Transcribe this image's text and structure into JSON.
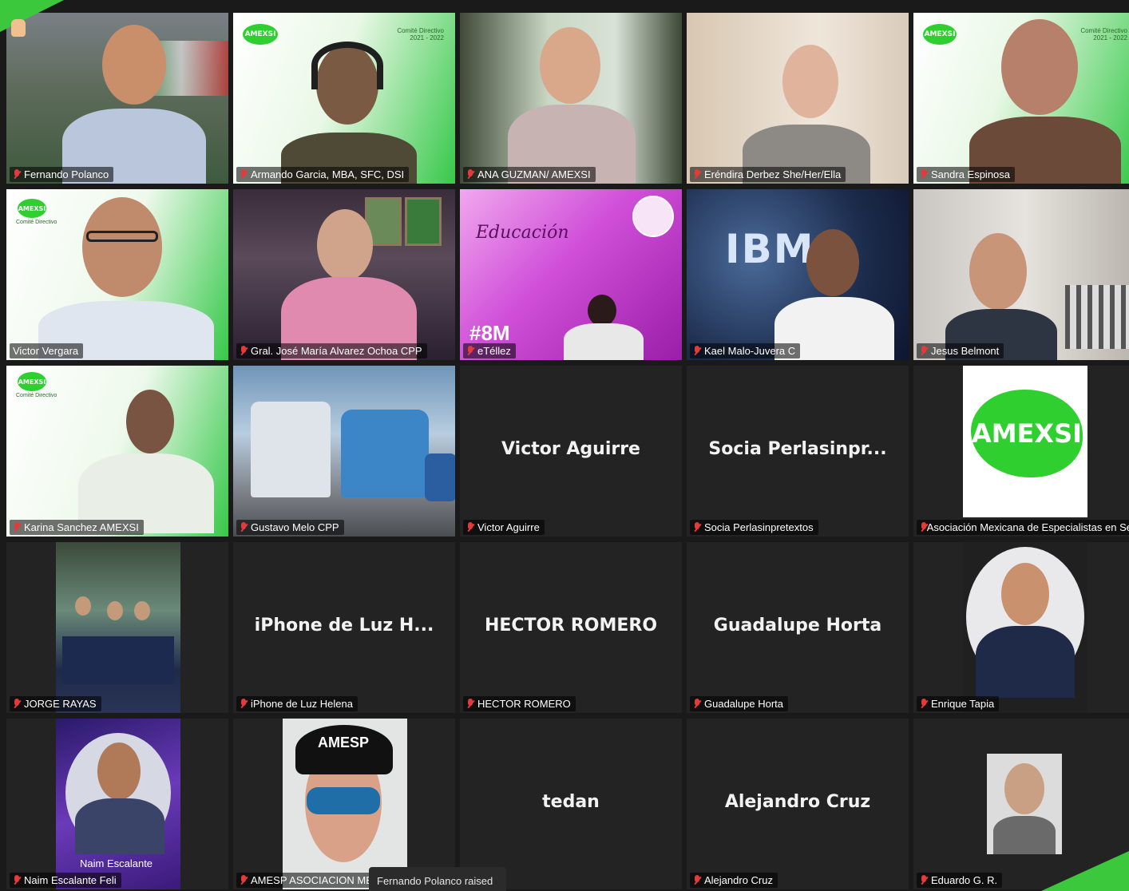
{
  "participants": [
    {
      "label": "Fernando Polanco"
    },
    {
      "label": "Armando Garcia, MBA, SFC, DSI",
      "banner": "Comité Directivo",
      "years": "2021 - 2022",
      "logo": "AMEXSI"
    },
    {
      "label": "ANA GUZMAN/ AMEXSI"
    },
    {
      "label": "Eréndira Derbez She/Her/Ella"
    },
    {
      "label": "Sandra Espinosa",
      "logo": "AMEXSI",
      "banner": "Comité Directivo",
      "years": "2021 - 2022"
    },
    {
      "label": "Victor Vergara",
      "logo": "AMEXSI",
      "banner": "Comité Directivo"
    },
    {
      "label": "Gral. José María Alvarez Ochoa CPP"
    },
    {
      "label": "eTéllez",
      "poster_script": "Educación",
      "poster_tag": "#8M"
    },
    {
      "label": "Kael Malo-Juvera C",
      "poster_logo": "IBM"
    },
    {
      "label": "Jesus Belmont"
    },
    {
      "label": "Karina Sanchez AMEXSI",
      "logo": "AMEXSI",
      "banner": "Comité Directivo"
    },
    {
      "label": "Gustavo Melo CPP"
    },
    {
      "label": "Victor Aguirre",
      "display_name": "Victor Aguirre"
    },
    {
      "label": "Socia Perlasinpretextos",
      "display_name": "Socia  Perlasinpr..."
    },
    {
      "label": "Asociación Mexicana de Especialistas en Se",
      "avatar_logo": "AMEXSI"
    },
    {
      "label": "JORGE RAYAS"
    },
    {
      "label": "iPhone de Luz Helena",
      "display_name": "iPhone de Luz H..."
    },
    {
      "label": "HECTOR ROMERO",
      "display_name": "HECTOR ROMERO"
    },
    {
      "label": "Guadalupe Horta",
      "display_name": "Guadalupe Horta"
    },
    {
      "label": "Enrique Tapia"
    },
    {
      "label": "Naim Escalante Feli",
      "avatar_caption": "Naim Escalante"
    },
    {
      "label": "AMESP ASOCIACION MEX",
      "cap_text": "AMESP"
    },
    {
      "label": "tedan",
      "display_name": "tedan"
    },
    {
      "label": "Alejandro Cruz",
      "display_name": "Alejandro Cruz"
    },
    {
      "label": "Eduardo G. R."
    }
  ],
  "notification": {
    "text": "Fernando Polanco raised"
  },
  "colors": {
    "accent_green": "#3cc83c",
    "active_speaker": "#c8d400",
    "muted_mic": "#e23b3b",
    "tile_bg": "#232323"
  }
}
